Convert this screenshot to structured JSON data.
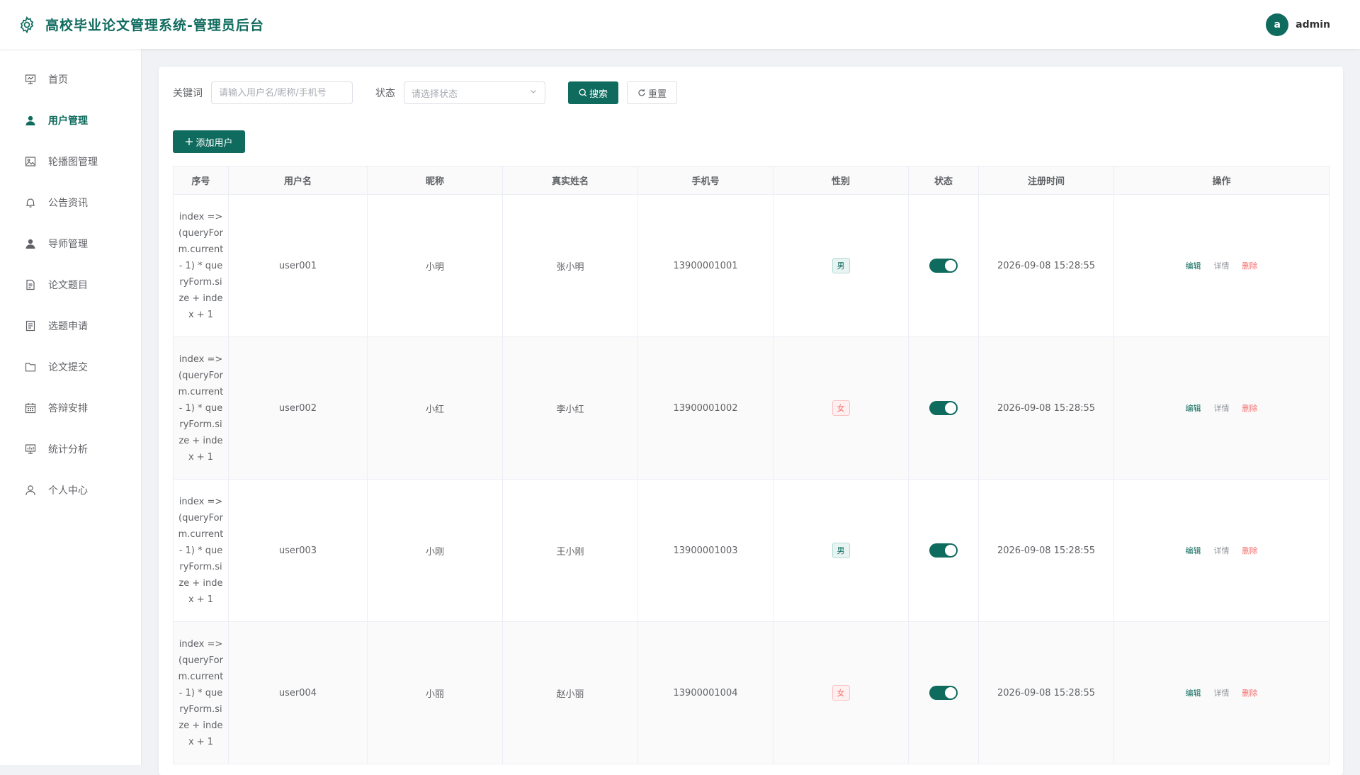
{
  "header": {
    "title": "高校毕业论文管理系统-管理员后台",
    "avatar_letter": "a",
    "username": "admin"
  },
  "sidebar": {
    "items": [
      {
        "label": "首页",
        "icon": "presentation-icon",
        "active": false
      },
      {
        "label": "用户管理",
        "icon": "user-icon",
        "active": true
      },
      {
        "label": "轮播图管理",
        "icon": "picture-icon",
        "active": false
      },
      {
        "label": "公告资讯",
        "icon": "bell-icon",
        "active": false
      },
      {
        "label": "导师管理",
        "icon": "user-icon",
        "active": false
      },
      {
        "label": "论文题目",
        "icon": "document-icon",
        "active": false
      },
      {
        "label": "选题申请",
        "icon": "tickets-icon",
        "active": false
      },
      {
        "label": "论文提交",
        "icon": "folder-icon",
        "active": false
      },
      {
        "label": "答辩安排",
        "icon": "calendar-icon",
        "active": false
      },
      {
        "label": "统计分析",
        "icon": "chart-icon",
        "active": false
      },
      {
        "label": "个人中心",
        "icon": "user-outline-icon",
        "active": false
      }
    ]
  },
  "search": {
    "keyword_label": "关键词",
    "keyword_placeholder": "请输入用户名/昵称/手机号",
    "status_label": "状态",
    "status_placeholder": "请选择状态",
    "search_label": "搜索",
    "reset_label": "重置"
  },
  "toolbar": {
    "add_label": "添加用户"
  },
  "table": {
    "columns": [
      "序号",
      "用户名",
      "昵称",
      "真实姓名",
      "手机号",
      "性别",
      "状态",
      "注册时间",
      "操作"
    ],
    "index_text": "index => (queryForm.current - 1) * queryForm.size + index + 1",
    "rows": [
      {
        "username": "user001",
        "nickname": "小明",
        "realname": "张小明",
        "phone": "13900001001",
        "gender": "男",
        "status_on": true,
        "reg_time": "2026-09-08 15:28:55"
      },
      {
        "username": "user002",
        "nickname": "小红",
        "realname": "李小红",
        "phone": "13900001002",
        "gender": "女",
        "status_on": true,
        "reg_time": "2026-09-08 15:28:55"
      },
      {
        "username": "user003",
        "nickname": "小刚",
        "realname": "王小刚",
        "phone": "13900001003",
        "gender": "男",
        "status_on": true,
        "reg_time": "2026-09-08 15:28:55"
      },
      {
        "username": "user004",
        "nickname": "小丽",
        "realname": "赵小丽",
        "phone": "13900001004",
        "gender": "女",
        "status_on": true,
        "reg_time": "2026-09-08 15:28:55"
      }
    ],
    "ops": {
      "edit": "编辑",
      "detail": "详情",
      "delete": "删除"
    }
  },
  "colors": {
    "primary": "#0f6b5e",
    "danger": "#f56c6c"
  }
}
